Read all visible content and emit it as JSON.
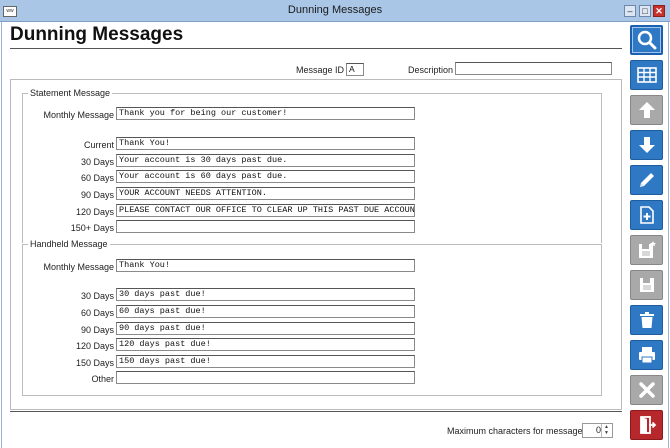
{
  "window": {
    "logo_text": "ww",
    "title": "Dunning Messages"
  },
  "page_title": "Dunning Messages",
  "header": {
    "message_id_label": "Message ID",
    "message_id_value": "A",
    "description_label": "Description",
    "description_value": ""
  },
  "statement": {
    "group_title": "Statement Message",
    "monthly_label": "Monthly Message",
    "monthly_value": "Thank you for being our customer!",
    "rows": [
      {
        "label": "Current",
        "value": "Thank You!"
      },
      {
        "label": "30 Days",
        "value": "Your account is 30 days past due."
      },
      {
        "label": "60 Days",
        "value": "Your account is 60 days past due."
      },
      {
        "label": "90 Days",
        "value": "YOUR ACCOUNT NEEDS ATTENTION."
      },
      {
        "label": "120 Days",
        "value": "PLEASE CONTACT OUR OFFICE TO CLEAR UP THIS PAST DUE ACCOUNT."
      },
      {
        "label": "150+ Days",
        "value": ""
      }
    ]
  },
  "handheld": {
    "group_title": "Handheld Message",
    "monthly_label": "Monthly Message",
    "monthly_value": "Thank You!",
    "rows": [
      {
        "label": "30 Days",
        "value": "30 days past due!"
      },
      {
        "label": "60 Days",
        "value": "60 days past due!"
      },
      {
        "label": "90 Days",
        "value": "90 days past due!"
      },
      {
        "label": "120 Days",
        "value": "120 days past due!"
      },
      {
        "label": "150 Days",
        "value": "150 days past due!"
      },
      {
        "label": "Other",
        "value": ""
      }
    ]
  },
  "footer": {
    "max_chars_label": "Maximum characters for message",
    "max_chars_value": "0"
  },
  "toolbar": {
    "buttons": [
      {
        "icon": "search-icon",
        "color": "#2f78c4"
      },
      {
        "icon": "grid-icon",
        "color": "#2f78c4"
      },
      {
        "icon": "arrow-up-icon",
        "color": "#a9a9a9"
      },
      {
        "icon": "arrow-down-icon",
        "color": "#2f78c4"
      },
      {
        "icon": "pencil-icon",
        "color": "#2f78c4"
      },
      {
        "icon": "new-document-icon",
        "color": "#2f78c4"
      },
      {
        "icon": "copy-save-icon",
        "color": "#a9a9a9"
      },
      {
        "icon": "save-icon",
        "color": "#a9a9a9"
      },
      {
        "icon": "trash-icon",
        "color": "#2f78c4"
      },
      {
        "icon": "print-icon",
        "color": "#2f78c4"
      },
      {
        "icon": "cancel-icon",
        "color": "#a9a9a9"
      },
      {
        "icon": "exit-door-icon",
        "color": "#b7282c"
      }
    ]
  }
}
